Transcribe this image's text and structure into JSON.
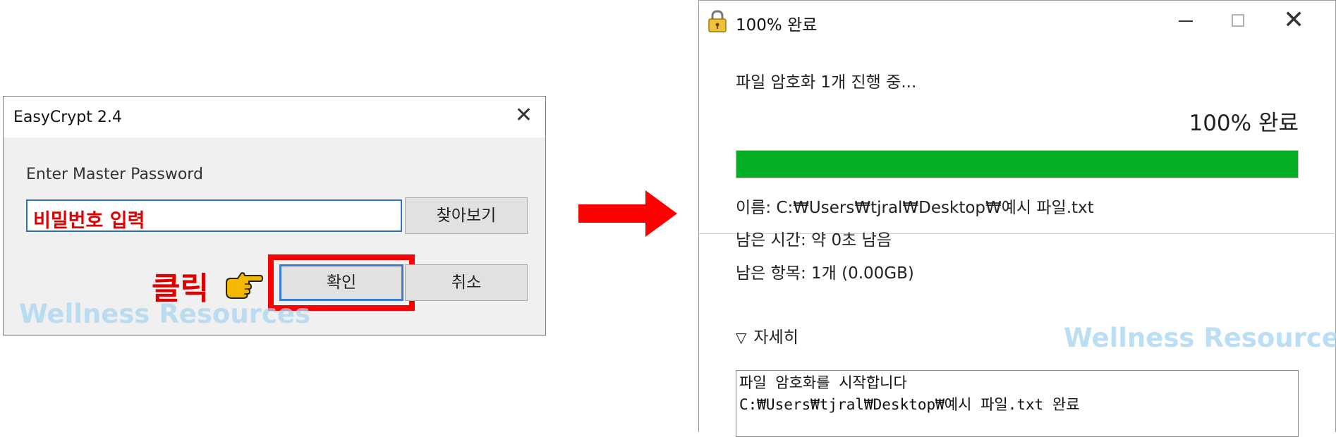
{
  "password_dialog": {
    "title": "EasyCrypt 2.4",
    "close_glyph": "✕",
    "label": "Enter Master Password",
    "password_value": "비밀번호 입력",
    "browse_label": "찾아보기",
    "ok_label": "확인",
    "cancel_label": "취소"
  },
  "annotation": {
    "click_label": "클릭",
    "highlight_color": "#ff0000",
    "pointer_icon": "pointing-hand-icon",
    "arrow_icon": "right-arrow-icon"
  },
  "progress_window": {
    "title": "100% 완료",
    "close_glyph": "✕",
    "operation_text": "파일 암호화 1개 진행 중...",
    "percent_text": "100% 완료",
    "progress": 1.0,
    "progress_color": "#06b025",
    "name_line": "이름: C:₩Users₩tjral₩Desktop₩예시 파일.txt",
    "time_line": "남은 시간: 약 0초 남음",
    "items_line": "남은 항목: 1개 (0.00GB)",
    "details_arrow": "▽",
    "details_label": "자세히",
    "log_lines": [
      "파일 암호화를 시작합니다",
      "C:₩Users₩tjral₩Desktop₩예시 파일.txt  완료"
    ]
  },
  "watermark": {
    "text": "Wellness Resources"
  }
}
